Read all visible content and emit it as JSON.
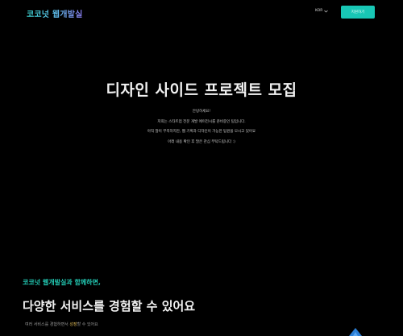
{
  "header": {
    "logo": "코코넛 웹개발실",
    "lang_label": "KOR",
    "contact_label": "지원하기"
  },
  "hero": {
    "title": "디자인 사이드 프로젝트 모집",
    "lines": [
      "안녕하세요!",
      "저희는 스타트업 전문 개발 에이전시를 준비중인 팀입니다.",
      "아직 많이 부족하지만, 웹 기획과 디자인이 가능한 팀원을 모시고 있어요",
      "아래 내용 확인 후 많은 관심 부탁드립니다 :)"
    ]
  },
  "section": {
    "subtitle": "코코넛 웹개발실과 함께하면,",
    "title": "다양한 서비스를 경험할 수 있어요",
    "desc_prefix": "여러 서비스를 경험하면서 ",
    "desc_highlight": "성장",
    "desc_suffix": "할 수 있어요"
  },
  "colors": {
    "background": "#000000",
    "accent": "#18c7b5",
    "highlight": "#e8c25a"
  }
}
